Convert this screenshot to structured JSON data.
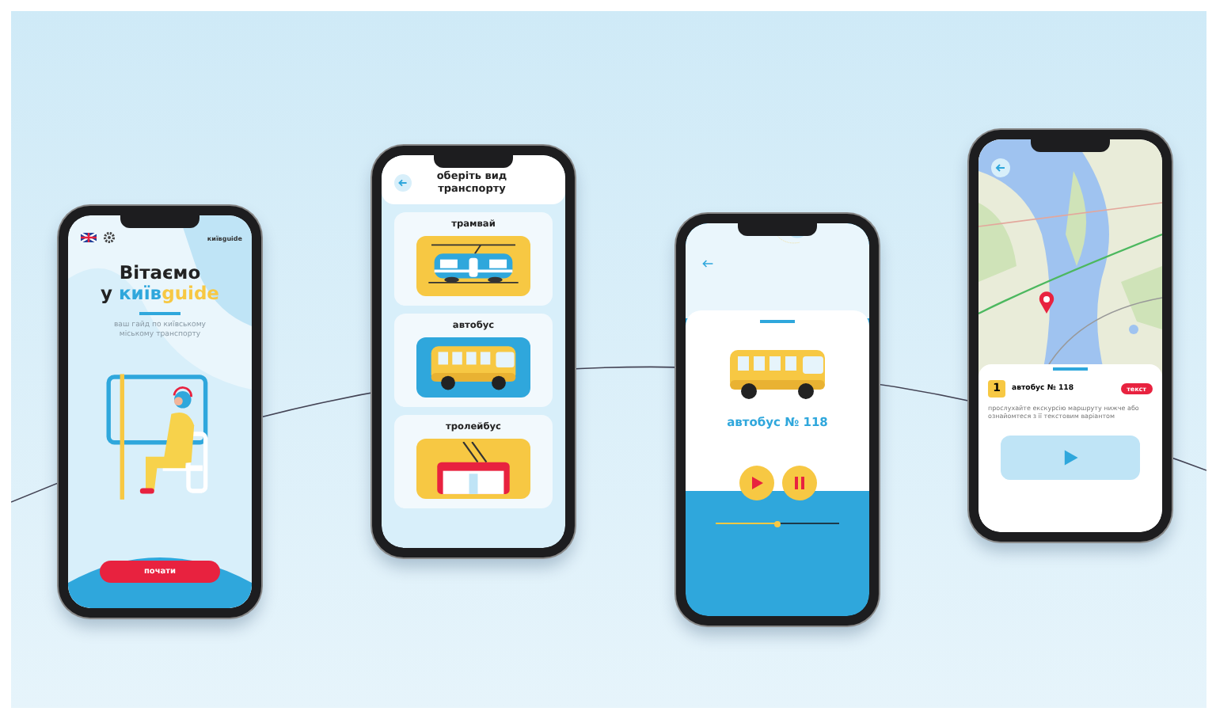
{
  "screens": [
    {
      "kind": "welcome",
      "logo": "київguide",
      "title": "Вітаємо",
      "title_prefix": "у",
      "brand_main": "київ",
      "brand_accent": "guide",
      "subtitle": "ваш гайд по київському міському транспорту",
      "button": "почати"
    },
    {
      "kind": "transport_list",
      "title": "оберіть вид транспорту",
      "items": [
        {
          "label": "трамвай",
          "kind": "tram"
        },
        {
          "label": "автобус",
          "kind": "bus"
        },
        {
          "label": "тролейбус",
          "kind": "trolleybus"
        }
      ]
    },
    {
      "kind": "player",
      "route": "автобус № 118",
      "level": 0.5
    },
    {
      "kind": "route",
      "number": "1",
      "route": "автобус № 118",
      "tag": "текст",
      "description": "прослухайте екскурсію маршруту нижче або ознайомтеся з її текстовим варіантом"
    }
  ]
}
